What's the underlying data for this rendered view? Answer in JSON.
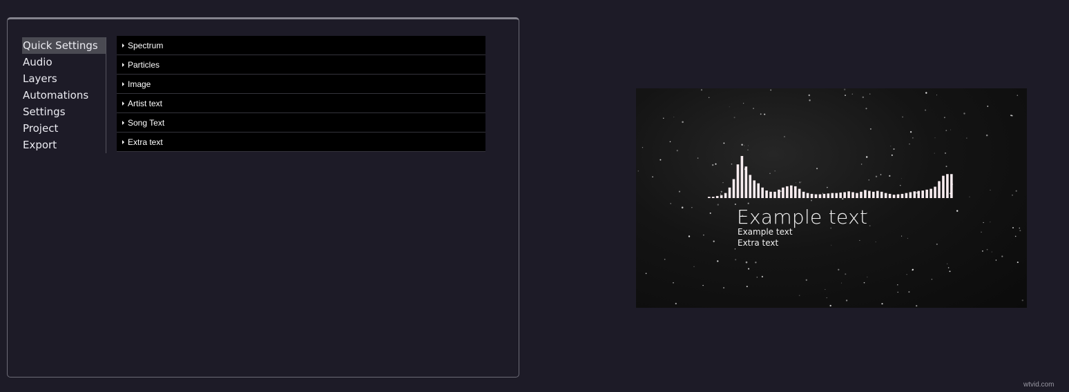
{
  "sidebar": {
    "items": [
      {
        "label": "Quick Settings",
        "active": true
      },
      {
        "label": "Audio"
      },
      {
        "label": "Layers"
      },
      {
        "label": "Automations"
      },
      {
        "label": "Settings"
      },
      {
        "label": "Project"
      },
      {
        "label": "Export"
      }
    ]
  },
  "sections": [
    {
      "label": "Spectrum"
    },
    {
      "label": "Particles"
    },
    {
      "label": "Image"
    },
    {
      "label": "Artist text"
    },
    {
      "label": "Song Text"
    },
    {
      "label": "Extra text"
    }
  ],
  "preview": {
    "title": "Example text",
    "subtitle": "Example text",
    "extra": "Extra text",
    "spectrum_levels": [
      0.03,
      0.03,
      0.05,
      0.07,
      0.12,
      0.25,
      0.45,
      0.8,
      1.0,
      0.75,
      0.55,
      0.42,
      0.35,
      0.25,
      0.18,
      0.15,
      0.15,
      0.2,
      0.25,
      0.28,
      0.3,
      0.28,
      0.22,
      0.15,
      0.12,
      0.1,
      0.09,
      0.09,
      0.1,
      0.11,
      0.12,
      0.12,
      0.13,
      0.14,
      0.16,
      0.14,
      0.12,
      0.15,
      0.19,
      0.17,
      0.15,
      0.17,
      0.15,
      0.12,
      0.1,
      0.08,
      0.09,
      0.1,
      0.12,
      0.14,
      0.16,
      0.17,
      0.18,
      0.2,
      0.22,
      0.27,
      0.4,
      0.53,
      0.57,
      0.57
    ],
    "colors": {
      "bars": "#f7ecef",
      "background": "#121212"
    }
  },
  "watermark": "wtvid.com"
}
